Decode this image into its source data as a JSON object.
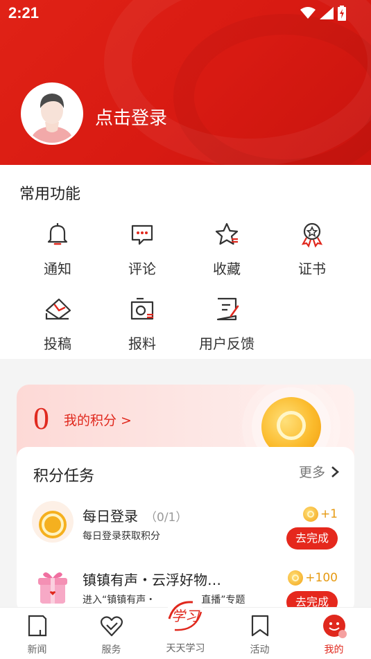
{
  "status_bar": {
    "time": "2:21"
  },
  "header": {
    "login_text": "点击登录"
  },
  "functions": {
    "title": "常用功能",
    "items": [
      {
        "label": "通知",
        "icon": "bell-icon"
      },
      {
        "label": "评论",
        "icon": "comment-icon"
      },
      {
        "label": "收藏",
        "icon": "star-icon"
      },
      {
        "label": "证书",
        "icon": "certificate-icon"
      },
      {
        "label": "投稿",
        "icon": "submit-icon"
      },
      {
        "label": "报料",
        "icon": "camera-report-icon"
      },
      {
        "label": "用户反馈",
        "icon": "feedback-icon"
      }
    ]
  },
  "points": {
    "value": "0",
    "link": "我的积分 >"
  },
  "tasks": {
    "title": "积分任务",
    "more": "更多",
    "items": [
      {
        "name": "每日登录",
        "count": "（0/1）",
        "desc": "每日登录获取积分",
        "reward": "+1",
        "button": "去完成",
        "icon": "coin-icon"
      },
      {
        "name": "镇镇有声・云浮好物…",
        "count": "",
        "desc": "进入“镇镇有声・",
        "desc_tail": "直播”专题",
        "reward": "+100",
        "button": "去完成",
        "icon": "gift-icon"
      }
    ]
  },
  "nav": {
    "items": [
      {
        "label": "新闻",
        "icon": "news-icon"
      },
      {
        "label": "服务",
        "icon": "heart-service-icon"
      },
      {
        "label": "天天学习",
        "icon": "xuexi-logo"
      },
      {
        "label": "活动",
        "icon": "bookmark-icon"
      },
      {
        "label": "我的",
        "icon": "profile-icon"
      }
    ],
    "logo_text": "学习"
  },
  "colors": {
    "brand_red": "#e0281d",
    "gold": "#f3a417"
  }
}
